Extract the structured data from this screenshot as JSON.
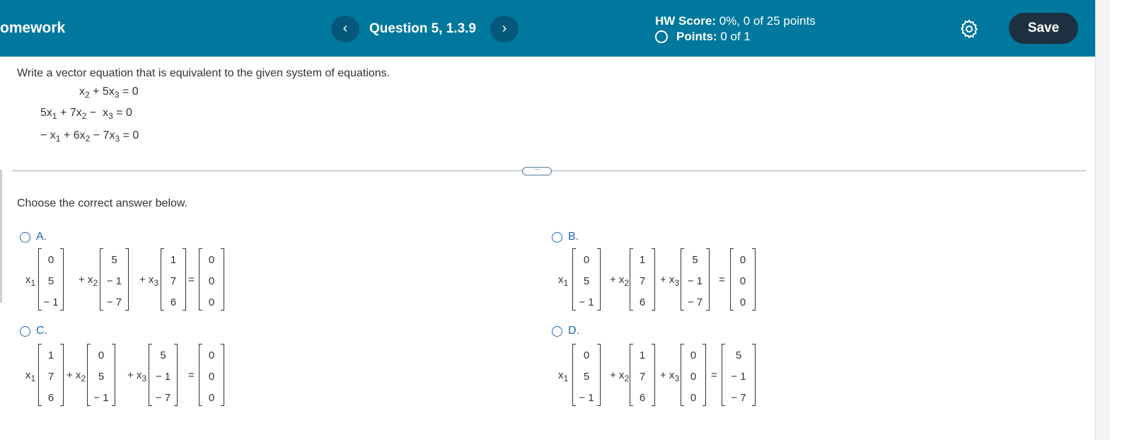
{
  "header": {
    "brand": "omework",
    "prev_label": "‹",
    "next_label": "›",
    "question_title": "Question 5, 1.3.9",
    "hw_score_label": "HW Score:",
    "hw_score_value": "0%, 0 of 25 points",
    "points_label": "Points:",
    "points_value": "0 of 1",
    "settings_icon": "gear-icon",
    "save_label": "Save",
    "bar_color": "#00789e"
  },
  "question": {
    "prompt": "Write a vector equation that is equivalent to the given system of equations.",
    "equations": [
      {
        "a": "",
        "b": "x",
        "bsub": "2",
        "op1": "+ 5",
        "c": "x",
        "csub": "3",
        "rhs": "= 0"
      },
      {
        "a": "5x",
        "asub": "1",
        "op0": "+ 7",
        "b": "x",
        "bsub": "2",
        "op1": "−",
        "c": "x",
        "csub": "3",
        "rhs": "= 0"
      },
      {
        "a": "− x",
        "asub": "1",
        "op0": "+ 6",
        "b": "x",
        "bsub": "2",
        "op1": "− 7",
        "c": "x",
        "csub": "3",
        "rhs": "= 0"
      }
    ]
  },
  "divider_handle": "···",
  "instruction": "Choose the correct answer below.",
  "options": [
    {
      "label": "A.",
      "terms": [
        {
          "coef": "x",
          "sub": "1",
          "vec": [
            "0",
            "5",
            "− 1"
          ]
        },
        {
          "coef": "+ x",
          "sub": "2",
          "vec": [
            "5",
            "− 1",
            "− 7"
          ]
        },
        {
          "coef": "+ x",
          "sub": "3",
          "vec": [
            "1",
            "7",
            "6"
          ]
        }
      ],
      "rhs": [
        "0",
        "0",
        "0"
      ]
    },
    {
      "label": "B.",
      "terms": [
        {
          "coef": "x",
          "sub": "1",
          "vec": [
            "0",
            "5",
            "− 1"
          ]
        },
        {
          "coef": "+ x",
          "sub": "2",
          "vec": [
            "1",
            "7",
            "6"
          ]
        },
        {
          "coef": "+ x",
          "sub": "3",
          "vec": [
            "5",
            "− 1",
            "− 7"
          ]
        }
      ],
      "rhs": [
        "0",
        "0",
        "0"
      ]
    },
    {
      "label": "C.",
      "terms": [
        {
          "coef": "x",
          "sub": "1",
          "vec": [
            "1",
            "7",
            "6"
          ]
        },
        {
          "coef": "+ x",
          "sub": "2",
          "vec": [
            "0",
            "5",
            "− 1"
          ]
        },
        {
          "coef": "+ x",
          "sub": "3",
          "vec": [
            "5",
            "− 1",
            "− 7"
          ]
        }
      ],
      "rhs": [
        "0",
        "0",
        "0"
      ]
    },
    {
      "label": "D.",
      "terms": [
        {
          "coef": "x",
          "sub": "1",
          "vec": [
            "0",
            "5",
            "− 1"
          ]
        },
        {
          "coef": "+ x",
          "sub": "2",
          "vec": [
            "1",
            "7",
            "6"
          ]
        },
        {
          "coef": "+ x",
          "sub": "3",
          "vec": [
            "0",
            "0",
            "0"
          ]
        }
      ],
      "rhs": [
        "5",
        "− 1",
        "− 7"
      ]
    }
  ],
  "colors": {
    "accent": "#2466b0",
    "save_button": "#1d3142",
    "nav_button": "#05587a"
  }
}
